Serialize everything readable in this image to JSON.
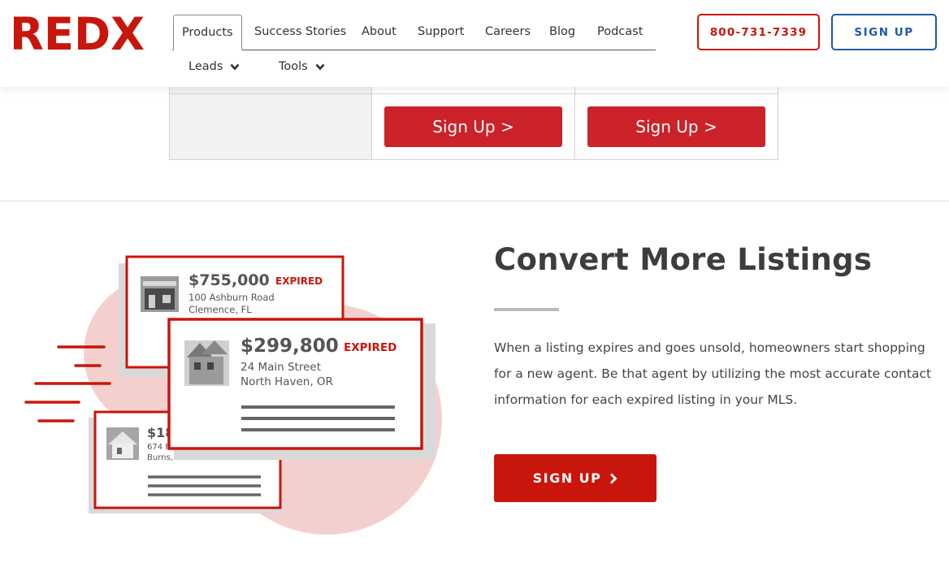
{
  "brand": {
    "logo_text": "REDX",
    "accent_color": "#c8160c",
    "secondary_color": "#1e5aa8"
  },
  "nav": {
    "tabs": [
      {
        "label": "Products"
      },
      {
        "label": "Success Stories"
      },
      {
        "label": "About"
      },
      {
        "label": "Support"
      },
      {
        "label": "Careers"
      },
      {
        "label": "Blog"
      },
      {
        "label": "Podcast"
      }
    ],
    "sub_items": [
      {
        "label": "Leads"
      },
      {
        "label": "Tools"
      }
    ]
  },
  "header_actions": {
    "phone": "800-731-7339",
    "signup": "SIGN UP"
  },
  "pricing_table": {
    "buttons": [
      "Sign Up >",
      "Sign Up >"
    ]
  },
  "feature": {
    "title": "Convert More Listings",
    "body": "When a listing expires and goes unsold, homeowners start shopping for a new agent. Be that agent by utilizing the most accurate contact information for each expired listing in your MLS.",
    "cta": "SIGN UP",
    "cta_icon": "chevron-right-icon"
  },
  "illustration": {
    "cards": [
      {
        "price": "$755,000",
        "status": "EXPIRED",
        "street": "100 Ashburn Road",
        "city": "Clemence, FL"
      },
      {
        "price": "$299,800",
        "status": "EXPIRED",
        "street": "24 Main Street",
        "city": "North Haven, OR"
      },
      {
        "price": "$18",
        "street": "674 F",
        "city": "Burns, NC"
      }
    ]
  }
}
